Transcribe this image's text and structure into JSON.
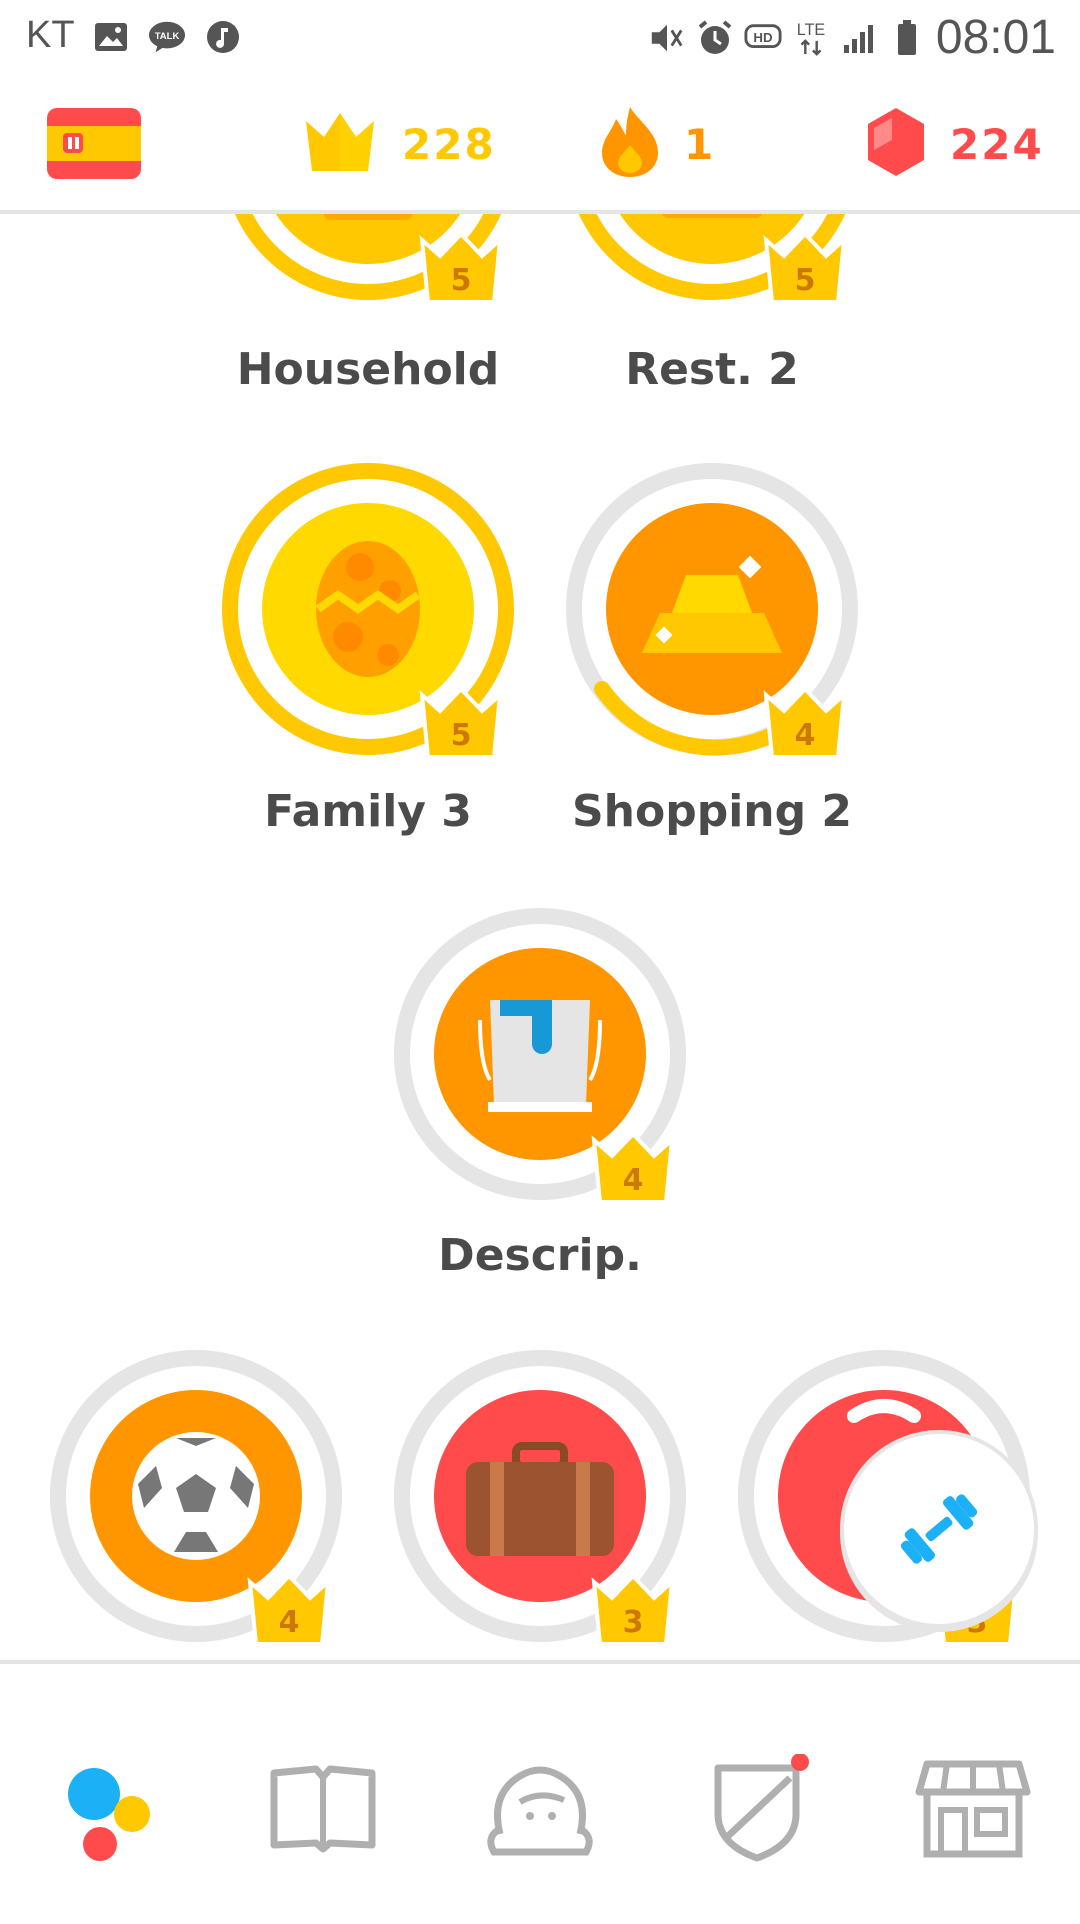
{
  "status_bar": {
    "carrier": "KT",
    "time": "08:01",
    "icons": [
      "gallery-icon",
      "talk-icon",
      "music-icon",
      "mute-icon",
      "alarm-icon",
      "hd-icon",
      "lte-icon",
      "signal-icon",
      "battery-icon"
    ]
  },
  "header": {
    "course_flag": "spain-flag",
    "crowns": "228",
    "streak": "1",
    "gems": "224"
  },
  "skills": [
    {
      "label": "Household",
      "level": "5"
    },
    {
      "label": "Rest. 2",
      "level": "5"
    },
    {
      "label": "Family 3",
      "level": "5"
    },
    {
      "label": "Shopping 2",
      "level": "4"
    },
    {
      "label": "Descrip.",
      "level": "4"
    },
    {
      "label": "",
      "level": "4"
    },
    {
      "label": "",
      "level": "3"
    },
    {
      "label": "",
      "level": "3"
    }
  ],
  "nav": {
    "items": [
      "learn-icon",
      "stories-icon",
      "profile-icon",
      "leagues-icon",
      "shop-icon"
    ]
  },
  "colors": {
    "gold": "#FFC800",
    "orange": "#FF9600",
    "red": "#FF4B4B",
    "blue": "#1CB0F6",
    "grey_ring": "#E5E5E5"
  }
}
